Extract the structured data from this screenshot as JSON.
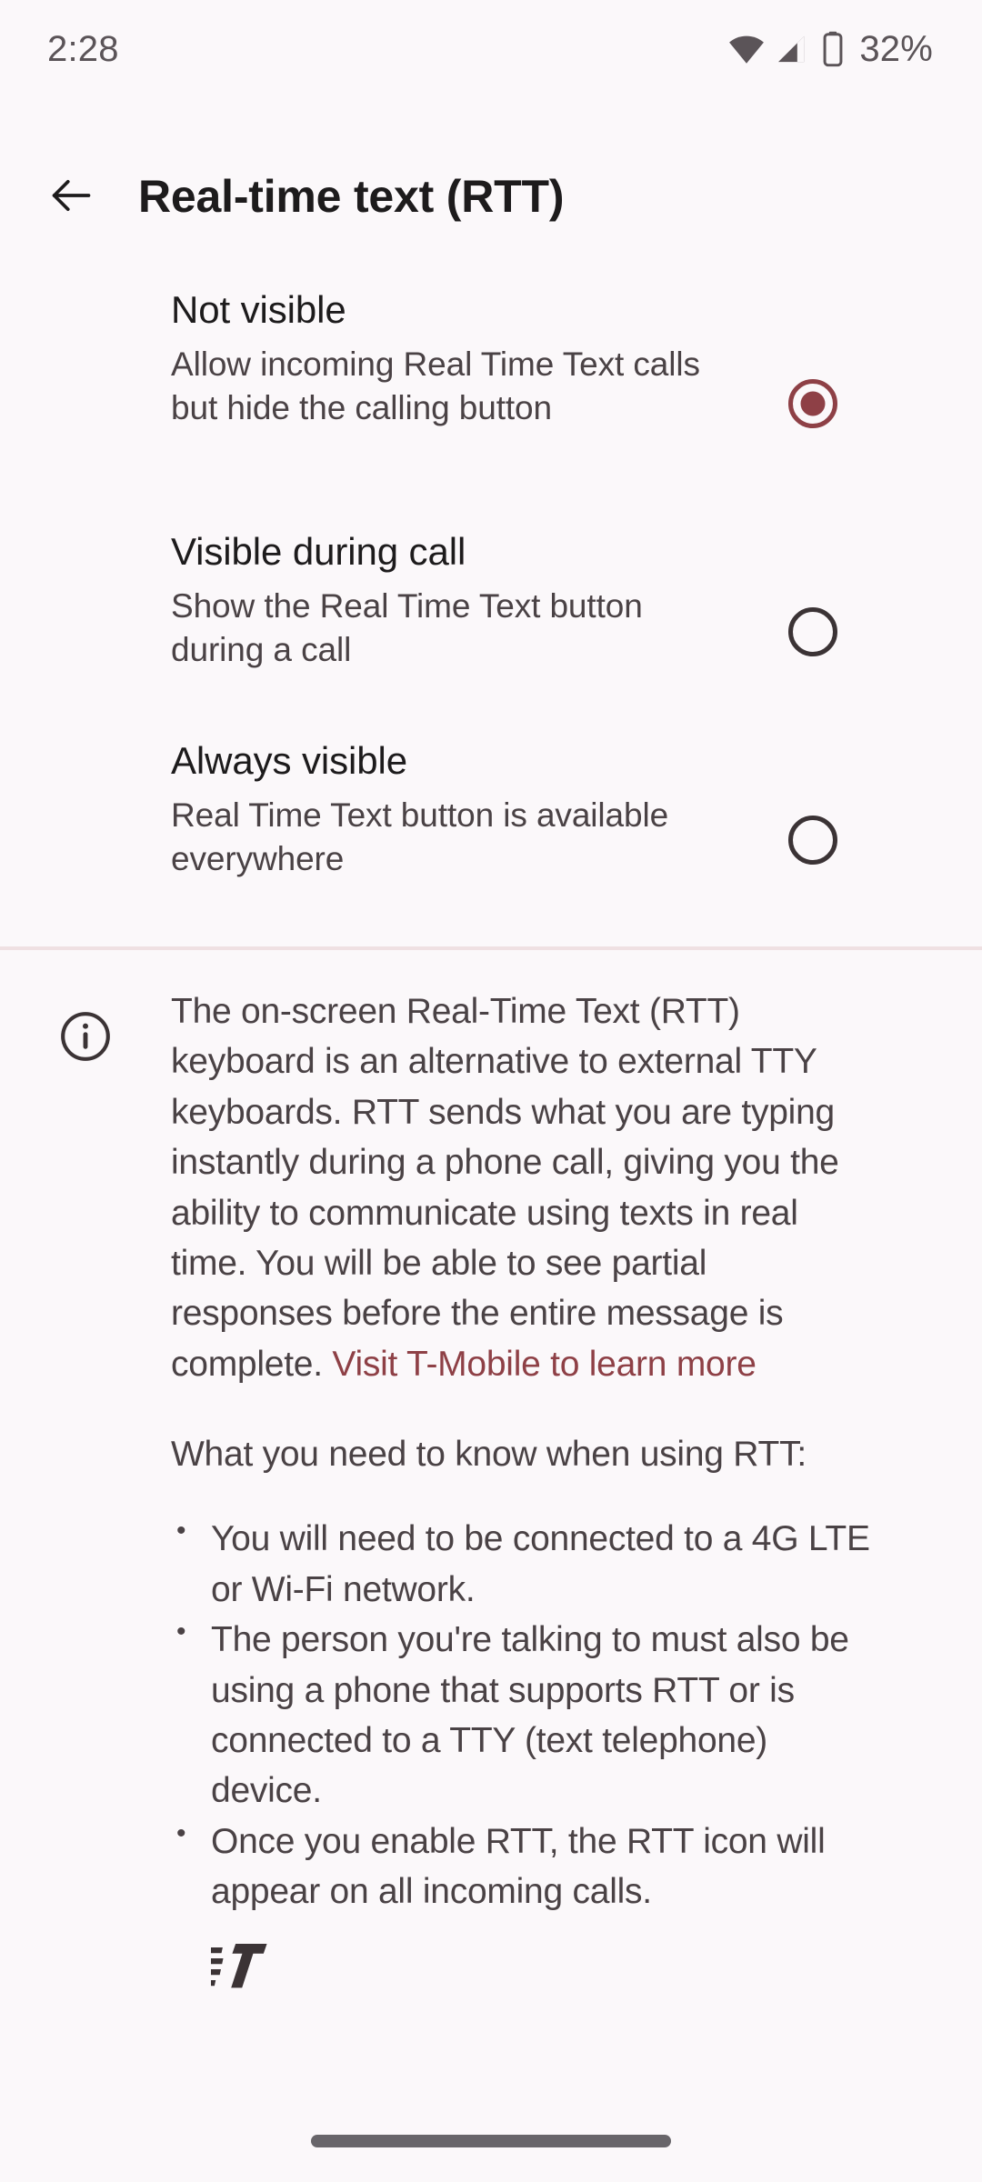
{
  "status_bar": {
    "time": "2:28",
    "battery_percent": "32%",
    "icons": [
      "wifi-icon",
      "cellular-signal-icon",
      "battery-icon"
    ]
  },
  "app_bar": {
    "back_icon": "arrow-back-icon",
    "title": "Real-time text (RTT)"
  },
  "colors": {
    "background": "#FBF8FA",
    "accent": "#8E4046",
    "primary_text": "#1D1B1C",
    "secondary_text": "#4A4245",
    "divider": "#EFE0E2",
    "status_text": "#5B5458",
    "nav_pill": "#68656A"
  },
  "options": [
    {
      "title": "Not visible",
      "description": "Allow incoming Real Time Text calls but hide the calling button",
      "selected": true
    },
    {
      "title": "Visible during call",
      "description": "Show the Real Time Text button during a call",
      "selected": false
    },
    {
      "title": "Always visible",
      "description": "Real Time Text button is available everywhere",
      "selected": false
    }
  ],
  "info": {
    "icon": "info-circle-icon",
    "paragraph_before_link": "The on-screen Real-Time Text (RTT) keyboard is an alternative to external TTY keyboards. RTT sends what you are typing instantly during a phone call, giving you the ability to communicate using texts in real time. You will be able to see partial responses before the entire message is complete. ",
    "link_text": "Visit T-Mobile to learn more",
    "subhead": "What you need to know when using RTT:",
    "bullets": [
      "You will need to be connected to a 4G LTE or Wi-Fi network.",
      "The person you're talking to must also be using a phone that supports RTT or is connected to a TTY (text telephone) device.",
      "Once you enable RTT, the RTT icon will appear on all incoming calls."
    ],
    "trailing_icon": "rtt-icon"
  },
  "nav": {
    "pill": "home-gesture-pill"
  }
}
